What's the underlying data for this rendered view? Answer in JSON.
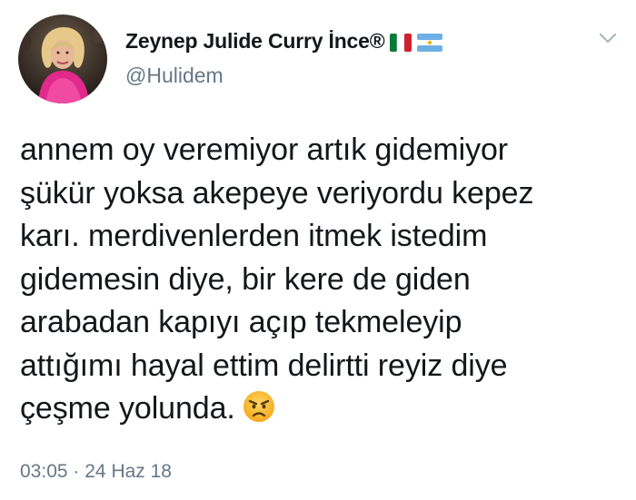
{
  "tweet": {
    "display_name": "Zeynep Julide Curry İnce®",
    "handle": "@Hulidem",
    "flags": [
      "italy-flag-icon",
      "argentina-flag-icon"
    ],
    "menu_icon": "chevron-down-icon",
    "text_lines": [
      "annem oy veremiyor artık gidemiyor",
      "şükür yoksa akepeye veriyordu kepez",
      "karı. merdivenlerden itmek istedim",
      "gidemesin diye, bir kere de giden",
      "arabadan kapıyı açıp tekmeleyip",
      "attığımı hayal ettim delirtti reyiz diye",
      "çeşme yolunda."
    ],
    "emoji": "angry-face-icon",
    "time": "03:05",
    "separator": "·",
    "date": "24 Haz 18"
  }
}
